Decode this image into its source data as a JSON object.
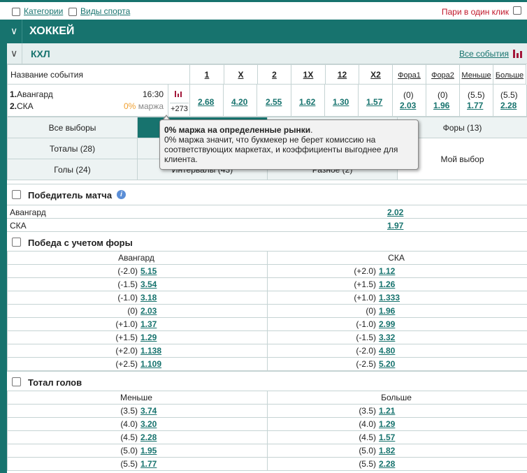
{
  "topbar": {
    "categories_label": "Категории",
    "sports_label": "Виды спорта",
    "one_click_label": "Пари в один клик"
  },
  "colors": {
    "accent": "#17736e",
    "brand_red": "#c0172a",
    "margin_orange": "#f0a030"
  },
  "sport": {
    "title": "ХОККЕЙ",
    "chevron": "chevron-down-icon"
  },
  "league": {
    "title": "КХЛ",
    "all_events": "Все события",
    "icon": "bars-chart-icon"
  },
  "columns": {
    "event_name": "Название события",
    "c1": "1",
    "cx": "X",
    "c2": "2",
    "c1x": "1X",
    "c12": "12",
    "cx2": "X2",
    "fora1": "Фора1",
    "fora2": "Фора2",
    "less": "Меньше",
    "more": "Больше"
  },
  "event": {
    "team1_num": "1.",
    "team1": "Авангард",
    "team2_num": "2.",
    "team2": "СКА",
    "time": "16:30",
    "margin_pct": "0%",
    "margin_label": "маржа",
    "more_count": "+273",
    "odds": {
      "w1": "2.68",
      "x": "4.20",
      "w2": "2.55",
      "x1": "1.62",
      "x12": "1.30",
      "x2": "1.57",
      "fora1_line": "(0)",
      "fora1": "2.03",
      "fora2_line": "(0)",
      "fora2": "1.96",
      "less_line": "(5.5)",
      "less": "1.77",
      "more_line": "(5.5)",
      "more": "2.28"
    }
  },
  "filters": {
    "all": "Все выборы",
    "foras": "Форы (13)",
    "totals": "Тоталы (28)",
    "goals": "Голы (24)",
    "intervals": "Интервалы (43)",
    "misc": "Разное (2)",
    "my_choice": "Мой выбор"
  },
  "tooltip": {
    "title": "0% маржа на определенные рынки",
    "title_dot": ".",
    "body": "0% маржа значит, что букмекер не берет комиссию на соответствующих маркетах, и коэффициенты выгоднее для клиента."
  },
  "winner": {
    "title": "Победитель матча",
    "rows": [
      {
        "team": "Авангард",
        "odd": "2.02"
      },
      {
        "team": "СКА",
        "odd": "1.97"
      }
    ]
  },
  "handicap": {
    "title": "Победа с учетом форы",
    "left_header": "Авангард",
    "right_header": "СКА",
    "rows": [
      {
        "l_line": "(-2.0)",
        "l_odd": "5.15",
        "r_line": "(+2.0)",
        "r_odd": "1.12"
      },
      {
        "l_line": "(-1.5)",
        "l_odd": "3.54",
        "r_line": "(+1.5)",
        "r_odd": "1.26"
      },
      {
        "l_line": "(-1.0)",
        "l_odd": "3.18",
        "r_line": "(+1.0)",
        "r_odd": "1.333"
      },
      {
        "l_line": "(0)",
        "l_odd": "2.03",
        "r_line": "(0)",
        "r_odd": "1.96"
      },
      {
        "l_line": "(+1.0)",
        "l_odd": "1.37",
        "r_line": "(-1.0)",
        "r_odd": "2.99"
      },
      {
        "l_line": "(+1.5)",
        "l_odd": "1.29",
        "r_line": "(-1.5)",
        "r_odd": "3.32"
      },
      {
        "l_line": "(+2.0)",
        "l_odd": "1.138",
        "r_line": "(-2.0)",
        "r_odd": "4.80"
      },
      {
        "l_line": "(+2.5)",
        "l_odd": "1.109",
        "r_line": "(-2.5)",
        "r_odd": "5.20"
      }
    ]
  },
  "total": {
    "title": "Тотал голов",
    "left_header": "Меньше",
    "right_header": "Больше",
    "rows": [
      {
        "l_line": "(3.5)",
        "l_odd": "3.74",
        "r_line": "(3.5)",
        "r_odd": "1.21"
      },
      {
        "l_line": "(4.0)",
        "l_odd": "3.20",
        "r_line": "(4.0)",
        "r_odd": "1.29"
      },
      {
        "l_line": "(4.5)",
        "l_odd": "2.28",
        "r_line": "(4.5)",
        "r_odd": "1.57"
      },
      {
        "l_line": "(5.0)",
        "l_odd": "1.95",
        "r_line": "(5.0)",
        "r_odd": "1.82"
      },
      {
        "l_line": "(5.5)",
        "l_odd": "1.77",
        "r_line": "(5.5)",
        "r_odd": "2.28"
      }
    ]
  }
}
